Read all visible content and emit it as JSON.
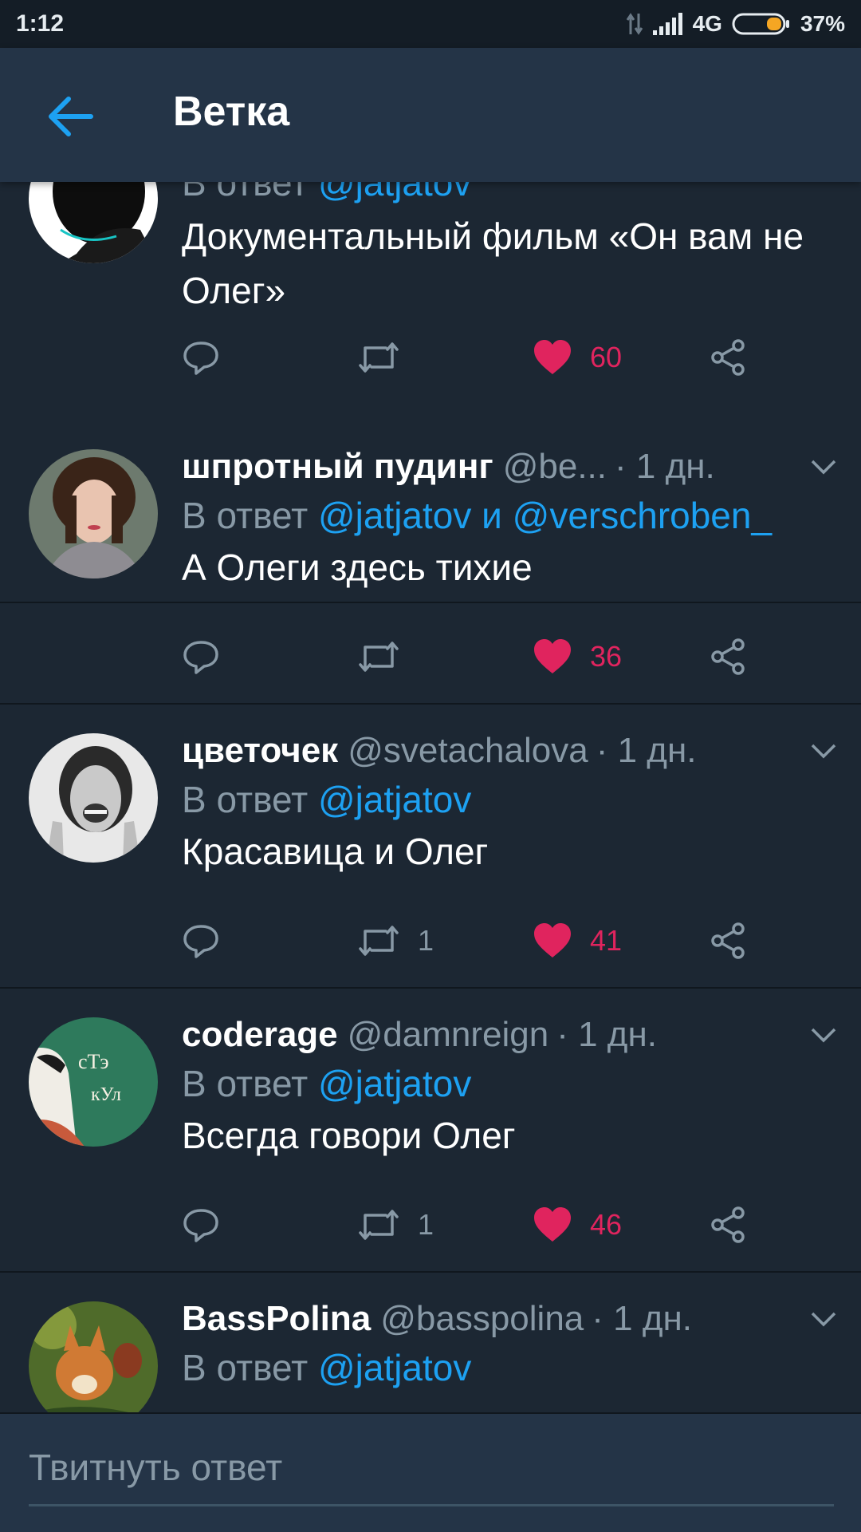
{
  "status_bar": {
    "time": "1:12",
    "network": "4G",
    "battery": "37%"
  },
  "header": {
    "title": "Ветка"
  },
  "tweets": [
    {
      "name": "",
      "handle": "",
      "time": "",
      "reply_prefix": "В ответ",
      "reply_mentions": "@jatjatov",
      "text": "Документальный фильм «Он вам не Олег»",
      "retweets": "",
      "likes": "60"
    },
    {
      "name": "шпротный пудинг",
      "handle": "@be...",
      "time": "· 1 дн.",
      "reply_prefix": "В ответ",
      "reply_mentions": "@jatjatov и @verschroben_",
      "text": "А Олеги здесь тихие",
      "retweets": "",
      "likes": "36"
    },
    {
      "name": "цветочек",
      "handle": "@svetachalova",
      "time": "· 1 дн.",
      "reply_prefix": "В ответ",
      "reply_mentions": "@jatjatov",
      "text": "Красавица и Олег",
      "retweets": "1",
      "likes": "41"
    },
    {
      "name": "coderage",
      "handle": "@damnreign",
      "time": "· 1 дн.",
      "reply_prefix": "В ответ",
      "reply_mentions": "@jatjatov",
      "text": "Всегда говори Олег",
      "retweets": "1",
      "likes": "46"
    },
    {
      "name": "BassPolina",
      "handle": "@basspolina",
      "time": "· 1 дн.",
      "reply_prefix": "В ответ",
      "reply_mentions": "@jatjatov",
      "text": "",
      "retweets": "",
      "likes": ""
    }
  ],
  "compose": {
    "placeholder": "Твитнуть ответ"
  },
  "colors": {
    "background": "#1c2733",
    "header": "#243447",
    "accent": "#1da1f2",
    "like": "#e0245e",
    "muted": "#8899a6"
  },
  "icons": [
    "back-arrow-icon",
    "reply-icon",
    "retweet-icon",
    "heart-icon",
    "share-icon",
    "chevron-down-icon"
  ]
}
